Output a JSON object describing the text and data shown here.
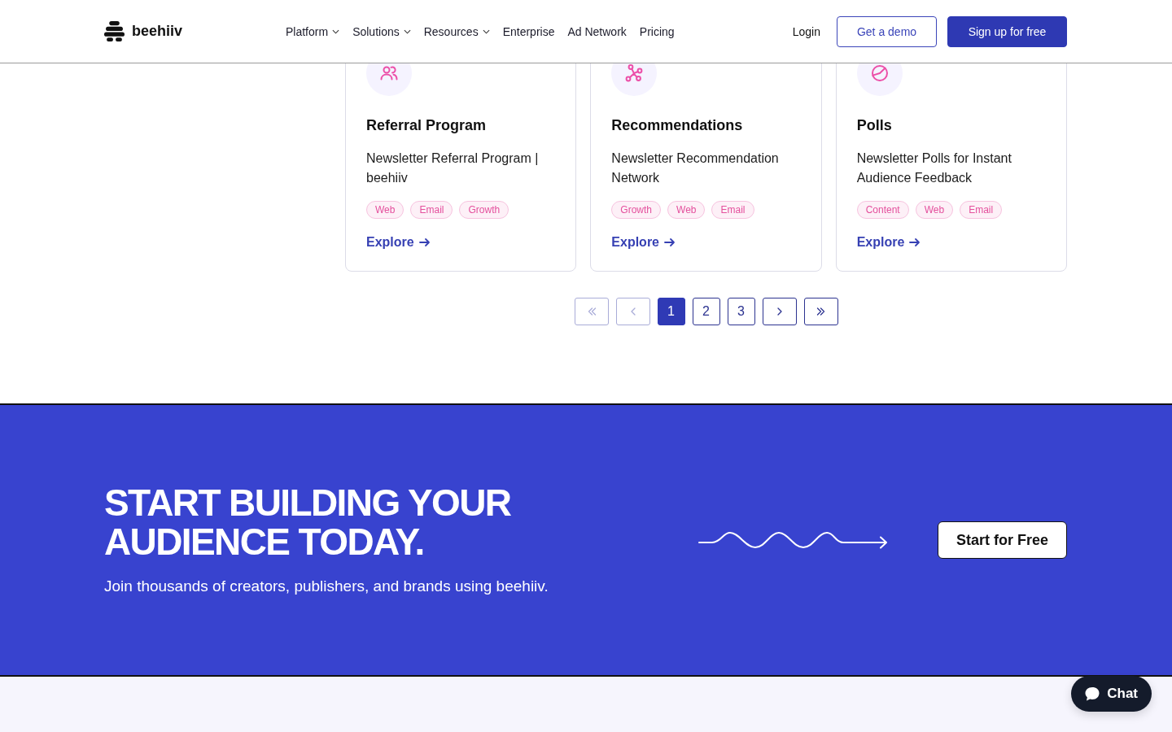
{
  "header": {
    "logo": "beehiiv",
    "nav": [
      {
        "label": "Platform",
        "dropdown": true
      },
      {
        "label": "Solutions",
        "dropdown": true
      },
      {
        "label": "Resources",
        "dropdown": true
      },
      {
        "label": "Enterprise",
        "dropdown": false
      },
      {
        "label": "Ad Network",
        "dropdown": false
      },
      {
        "label": "Pricing",
        "dropdown": false
      }
    ],
    "login": "Login",
    "buttons": [
      {
        "label": "Get a demo",
        "kind": "outline"
      },
      {
        "label": "Sign up for free",
        "kind": "filled"
      }
    ]
  },
  "cards": [
    {
      "title": "Referral Program",
      "description": "Newsletter Referral Program | beehiiv",
      "tags": [
        "Web",
        "Email",
        "Growth"
      ],
      "link": "Explore"
    },
    {
      "title": "Recommendations",
      "description": "Newsletter Recommendation Network",
      "tags": [
        "Growth",
        "Web",
        "Email"
      ],
      "link": "Explore"
    },
    {
      "title": "Polls",
      "description": "Newsletter Polls for Instant Audience Feedback",
      "tags": [
        "Content",
        "Web",
        "Email"
      ],
      "link": "Explore"
    }
  ],
  "pagination": {
    "first": {
      "disabled": true
    },
    "previous": {
      "disabled": true
    },
    "pages": [
      {
        "label": "1",
        "selected": true
      },
      {
        "label": "2",
        "selected": false
      },
      {
        "label": "3",
        "selected": false
      }
    ],
    "next": {
      "disabled": false
    },
    "last": {
      "disabled": false
    }
  },
  "cta": {
    "heading_lines": [
      "START BUILDING YOUR",
      "AUDIENCE TODAY."
    ],
    "subtitle": "Join thousands of creators, publishers, and brands using beehiiv.",
    "button": "Start for Free"
  },
  "chat": {
    "label": "Chat"
  }
}
